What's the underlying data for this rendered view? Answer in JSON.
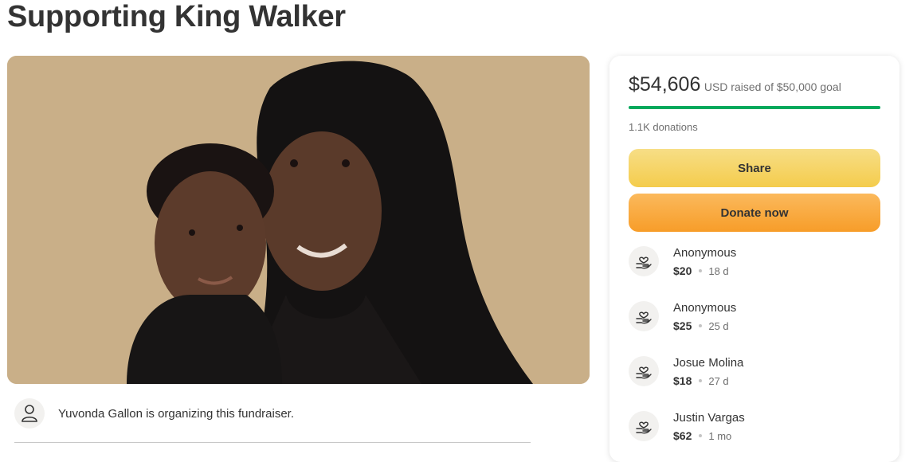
{
  "page": {
    "title": "Supporting King Walker"
  },
  "hero": {
    "image_icon": "photo-of-mother-and-son"
  },
  "organizer": {
    "icon": "user-icon",
    "text": "Yuvonda Gallon is organizing this fundraiser."
  },
  "summary": {
    "amount": "$54,606",
    "currency_goal_text": "USD raised of $50,000 goal",
    "progress_fraction": 1.0,
    "donations_text": "1.1K donations",
    "progress_color": "#02a95c"
  },
  "buttons": {
    "share_label": "Share",
    "donate_label": "Donate now"
  },
  "donors": [
    {
      "name": "Anonymous",
      "amount": "$20",
      "time": "18 d",
      "icon": "heart-hand-icon"
    },
    {
      "name": "Anonymous",
      "amount": "$25",
      "time": "25 d",
      "icon": "heart-hand-icon"
    },
    {
      "name": "Josue Molina",
      "amount": "$18",
      "time": "27 d",
      "icon": "heart-hand-icon"
    },
    {
      "name": "Justin Vargas",
      "amount": "$62",
      "time": "1 mo",
      "icon": "heart-hand-icon"
    }
  ]
}
